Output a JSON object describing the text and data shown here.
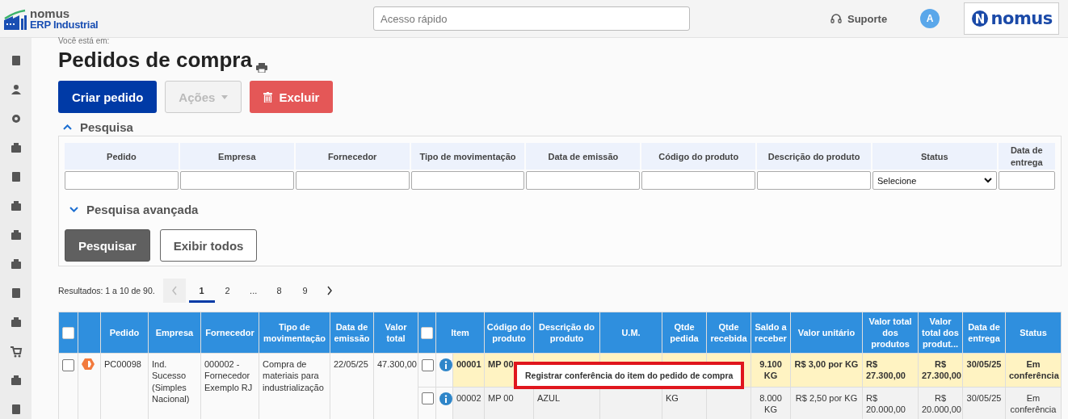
{
  "header": {
    "logo_name": "nomus",
    "logo_subtitle": "ERP Industrial",
    "search": {
      "placeholder": "Acesso rápido"
    },
    "support": "Suporte",
    "avatar": "A",
    "brand": "nomus"
  },
  "breadcrumb": "Você está em:",
  "title": "Pedidos de compra",
  "actions": [
    {
      "label": "Criar pedido",
      "kind": "primary",
      "disabled": false
    },
    {
      "label": "Ações",
      "kind": "dropdown",
      "disabled": true
    },
    {
      "label": "Excluir",
      "kind": "danger",
      "disabled": false
    }
  ],
  "search": {
    "title": "Pesquisa",
    "expanded": true,
    "filters": [
      {
        "label": "Pedido",
        "kind": "text"
      },
      {
        "label": "Empresa",
        "kind": "text"
      },
      {
        "label": "Fornecedor",
        "kind": "text"
      },
      {
        "label": "Tipo de movimentação",
        "kind": "text"
      },
      {
        "label": "Data de emissão",
        "kind": "text"
      },
      {
        "label": "Código do produto",
        "kind": "text"
      },
      {
        "label": "Descrição do produto",
        "kind": "text"
      },
      {
        "label": "Status",
        "kind": "select",
        "value": "Selecione"
      },
      {
        "label": "Data de entrega",
        "kind": "text"
      }
    ],
    "advanced": {
      "label": "Pesquisa avançada",
      "expanded": false
    },
    "buttons": [
      {
        "label": "Pesquisar",
        "kind": "primary"
      },
      {
        "label": "Exibir todos",
        "kind": "outline"
      }
    ]
  },
  "pagination": {
    "results": "Resultados: 1 a 10 de 90.",
    "pages": [
      {
        "label": "1",
        "selected": true
      },
      {
        "label": "2",
        "selected": false
      },
      {
        "label": "...",
        "selected": false
      },
      {
        "label": "8",
        "selected": false
      },
      {
        "label": "9",
        "selected": false
      }
    ]
  },
  "table": {
    "orders_all_checked": false,
    "items_all_checked": false,
    "order_columns": [
      "Pedido",
      "Empresa",
      "Fornecedor",
      "Tipo de movimentação",
      "Data de emissão",
      "Valor total"
    ],
    "item_columns": [
      "Item",
      "Código do produto",
      "Descrição do produto",
      "U.M.",
      "Qtde pedida",
      "Qtde recebida",
      "Saldo a receber",
      "Valor unitário",
      "Valor total dos produtos",
      "Valor total dos produt...",
      "Data de entrega",
      "Status"
    ],
    "orders": [
      {
        "checked": false,
        "pedido": "PC00098",
        "empresa": "Ind. Sucesso (Simples Nacional)",
        "fornecedor": "000002 - Fornecedor Exemplo RJ",
        "tipo": "Compra de materiais para industrialização",
        "data_emissao": "22/05/25",
        "valor_total": "47.300,00",
        "items": [
          {
            "checked": false,
            "selected": true,
            "cells": [
              "00001",
              "MP 00",
              null,
              null,
              null,
              null,
              "9.100 KG",
              "R$ 3,00 por KG",
              "R$ 27.300,00",
              "R$ 27.300,00",
              "30/05/25",
              "Em conferência"
            ]
          },
          {
            "checked": false,
            "selected": false,
            "cells": [
              "00002",
              "MP 00",
              "AZUL",
              null,
              "KG",
              null,
              "8.000 KG",
              "R$ 2,50 por KG",
              "R$ 20.000,00",
              "R$ 20.000,00",
              "30/05/25",
              "Em conferência"
            ]
          }
        ]
      }
    ]
  },
  "tooltip": "Registrar conferência do item do pedido de compra"
}
